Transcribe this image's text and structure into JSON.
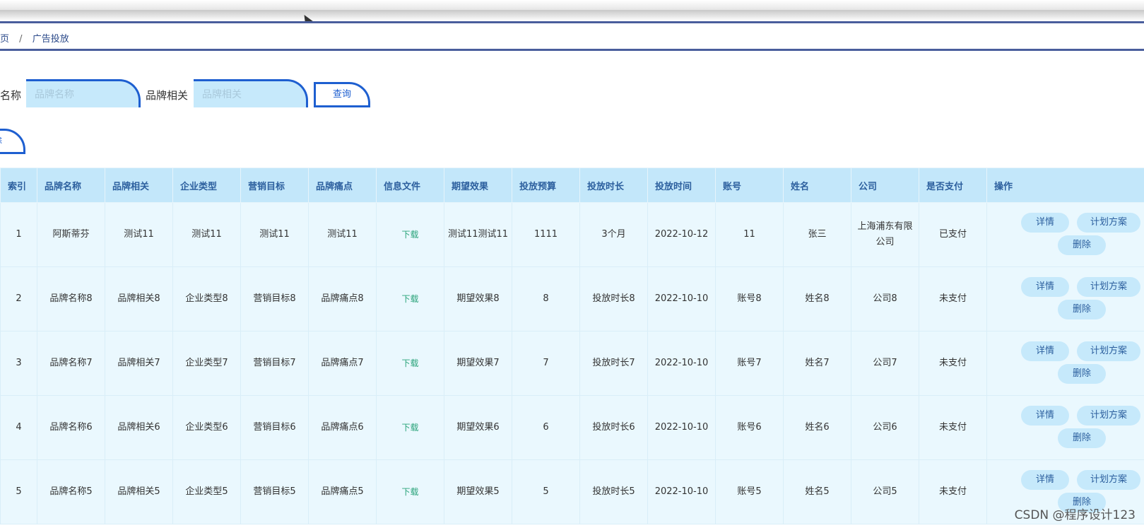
{
  "breadcrumb": {
    "home": "首页",
    "separator": "/",
    "current": "广告投放"
  },
  "search": {
    "brand_name_label": "品牌名称",
    "brand_name_placeholder": "品牌名称",
    "brand_related_label": "品牌相关",
    "brand_related_placeholder": "品牌相关",
    "query_button": "查询",
    "delete_button": "删除"
  },
  "table": {
    "headers": [
      "索引",
      "品牌名称",
      "品牌相关",
      "企业类型",
      "营销目标",
      "品牌痛点",
      "信息文件",
      "期望效果",
      "投放预算",
      "投放时长",
      "投放时间",
      "账号",
      "姓名",
      "公司",
      "是否支付",
      "操作"
    ],
    "rows": [
      {
        "index": "1",
        "brand": "阿斯蒂芬",
        "related": "测试11",
        "type": "测试11",
        "goal": "测试11",
        "pain": "测试11",
        "file": "下载",
        "effect": "测试11测试11",
        "budget": "1111",
        "duration": "3个月",
        "time": "2022-10-12",
        "account": "11",
        "name": "张三",
        "company": "上海浦东有限公司",
        "paid": "已支付"
      },
      {
        "index": "2",
        "brand": "品牌名称8",
        "related": "品牌相关8",
        "type": "企业类型8",
        "goal": "营销目标8",
        "pain": "品牌痛点8",
        "file": "下载",
        "effect": "期望效果8",
        "budget": "8",
        "duration": "投放时长8",
        "time": "2022-10-10",
        "account": "账号8",
        "name": "姓名8",
        "company": "公司8",
        "paid": "未支付"
      },
      {
        "index": "3",
        "brand": "品牌名称7",
        "related": "品牌相关7",
        "type": "企业类型7",
        "goal": "营销目标7",
        "pain": "品牌痛点7",
        "file": "下载",
        "effect": "期望效果7",
        "budget": "7",
        "duration": "投放时长7",
        "time": "2022-10-10",
        "account": "账号7",
        "name": "姓名7",
        "company": "公司7",
        "paid": "未支付"
      },
      {
        "index": "4",
        "brand": "品牌名称6",
        "related": "品牌相关6",
        "type": "企业类型6",
        "goal": "营销目标6",
        "pain": "品牌痛点6",
        "file": "下载",
        "effect": "期望效果6",
        "budget": "6",
        "duration": "投放时长6",
        "time": "2022-10-10",
        "account": "账号6",
        "name": "姓名6",
        "company": "公司6",
        "paid": "未支付"
      },
      {
        "index": "5",
        "brand": "品牌名称5",
        "related": "品牌相关5",
        "type": "企业类型5",
        "goal": "营销目标5",
        "pain": "品牌痛点5",
        "file": "下载",
        "effect": "期望效果5",
        "budget": "5",
        "duration": "投放时长5",
        "time": "2022-10-10",
        "account": "账号5",
        "name": "姓名5",
        "company": "公司5",
        "paid": "未支付"
      }
    ],
    "actions": {
      "detail": "详情",
      "plan": "计划方案",
      "delete": "删除"
    }
  },
  "watermark": "CSDN @程序设计123",
  "colors": {
    "accent": "#1e5fd0",
    "header_bg": "#c3e7fa",
    "row_bg": "#eaf8fe",
    "download": "#2aa37a"
  }
}
